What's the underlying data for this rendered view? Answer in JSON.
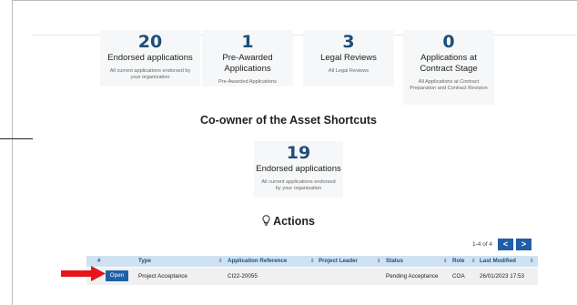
{
  "colors": {
    "accent": "#1f5fa6",
    "number": "#1f4e79",
    "table_header_bg": "#cfe2f3",
    "arrow": "#e8161b"
  },
  "summary_cards": [
    {
      "number": "20",
      "title": "Endorsed applications",
      "desc": "All current applications endorsed by your organization"
    },
    {
      "number": "1",
      "title": "Pre-Awarded Applications",
      "desc": "Pre-Awarded Applications"
    },
    {
      "number": "3",
      "title": "Legal Reviews",
      "desc": "All Legal Reviews"
    },
    {
      "number": "0",
      "title": "Applications at Contract Stage",
      "desc": "All Applications at Contract Preparation and Contract Revision"
    }
  ],
  "coowner": {
    "title": "Co-owner of the Asset Shortcuts",
    "card": {
      "number": "19",
      "title": "Endorsed applications",
      "desc": "All current applications endorsed by your organization"
    }
  },
  "actions": {
    "title": "Actions",
    "icon": "lightbulb-icon",
    "pager": {
      "count": "1-4 of 4",
      "prev": "<",
      "next": ">"
    },
    "table": {
      "headers": [
        "#",
        "Type",
        "Application Reference",
        "Project Leader",
        "Status",
        "Role",
        "Last Modified"
      ],
      "rows": [
        {
          "button": "Open",
          "type": "Project Acceptance",
          "reference": "CI22-20055",
          "leader": "",
          "status": "Pending Acceptance",
          "role": "COA",
          "modified": "26/01/2023 17:53"
        }
      ]
    }
  }
}
